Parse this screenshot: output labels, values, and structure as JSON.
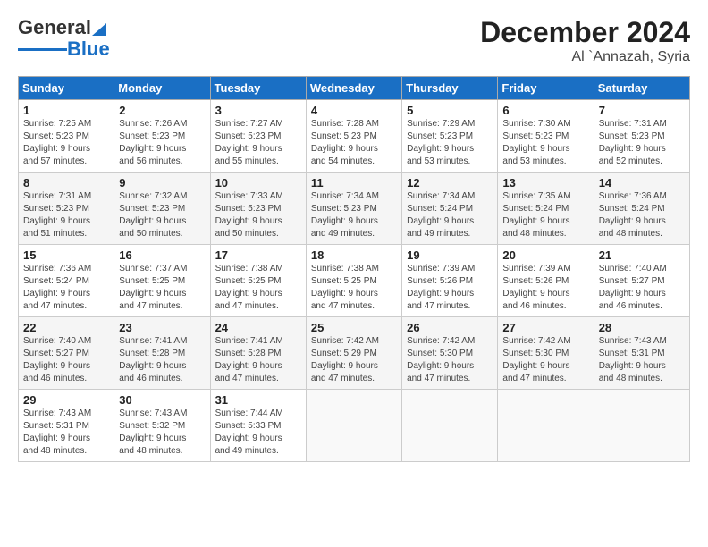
{
  "header": {
    "logo_line1": "General",
    "logo_line2": "Blue",
    "title": "December 2024",
    "subtitle": "Al `Annazah, Syria"
  },
  "columns": [
    "Sunday",
    "Monday",
    "Tuesday",
    "Wednesday",
    "Thursday",
    "Friday",
    "Saturday"
  ],
  "weeks": [
    [
      {
        "day": "1",
        "info": "Sunrise: 7:25 AM\nSunset: 5:23 PM\nDaylight: 9 hours\nand 57 minutes."
      },
      {
        "day": "2",
        "info": "Sunrise: 7:26 AM\nSunset: 5:23 PM\nDaylight: 9 hours\nand 56 minutes."
      },
      {
        "day": "3",
        "info": "Sunrise: 7:27 AM\nSunset: 5:23 PM\nDaylight: 9 hours\nand 55 minutes."
      },
      {
        "day": "4",
        "info": "Sunrise: 7:28 AM\nSunset: 5:23 PM\nDaylight: 9 hours\nand 54 minutes."
      },
      {
        "day": "5",
        "info": "Sunrise: 7:29 AM\nSunset: 5:23 PM\nDaylight: 9 hours\nand 53 minutes."
      },
      {
        "day": "6",
        "info": "Sunrise: 7:30 AM\nSunset: 5:23 PM\nDaylight: 9 hours\nand 53 minutes."
      },
      {
        "day": "7",
        "info": "Sunrise: 7:31 AM\nSunset: 5:23 PM\nDaylight: 9 hours\nand 52 minutes."
      }
    ],
    [
      {
        "day": "8",
        "info": "Sunrise: 7:31 AM\nSunset: 5:23 PM\nDaylight: 9 hours\nand 51 minutes."
      },
      {
        "day": "9",
        "info": "Sunrise: 7:32 AM\nSunset: 5:23 PM\nDaylight: 9 hours\nand 50 minutes."
      },
      {
        "day": "10",
        "info": "Sunrise: 7:33 AM\nSunset: 5:23 PM\nDaylight: 9 hours\nand 50 minutes."
      },
      {
        "day": "11",
        "info": "Sunrise: 7:34 AM\nSunset: 5:23 PM\nDaylight: 9 hours\nand 49 minutes."
      },
      {
        "day": "12",
        "info": "Sunrise: 7:34 AM\nSunset: 5:24 PM\nDaylight: 9 hours\nand 49 minutes."
      },
      {
        "day": "13",
        "info": "Sunrise: 7:35 AM\nSunset: 5:24 PM\nDaylight: 9 hours\nand 48 minutes."
      },
      {
        "day": "14",
        "info": "Sunrise: 7:36 AM\nSunset: 5:24 PM\nDaylight: 9 hours\nand 48 minutes."
      }
    ],
    [
      {
        "day": "15",
        "info": "Sunrise: 7:36 AM\nSunset: 5:24 PM\nDaylight: 9 hours\nand 47 minutes."
      },
      {
        "day": "16",
        "info": "Sunrise: 7:37 AM\nSunset: 5:25 PM\nDaylight: 9 hours\nand 47 minutes."
      },
      {
        "day": "17",
        "info": "Sunrise: 7:38 AM\nSunset: 5:25 PM\nDaylight: 9 hours\nand 47 minutes."
      },
      {
        "day": "18",
        "info": "Sunrise: 7:38 AM\nSunset: 5:25 PM\nDaylight: 9 hours\nand 47 minutes."
      },
      {
        "day": "19",
        "info": "Sunrise: 7:39 AM\nSunset: 5:26 PM\nDaylight: 9 hours\nand 47 minutes."
      },
      {
        "day": "20",
        "info": "Sunrise: 7:39 AM\nSunset: 5:26 PM\nDaylight: 9 hours\nand 46 minutes."
      },
      {
        "day": "21",
        "info": "Sunrise: 7:40 AM\nSunset: 5:27 PM\nDaylight: 9 hours\nand 46 minutes."
      }
    ],
    [
      {
        "day": "22",
        "info": "Sunrise: 7:40 AM\nSunset: 5:27 PM\nDaylight: 9 hours\nand 46 minutes."
      },
      {
        "day": "23",
        "info": "Sunrise: 7:41 AM\nSunset: 5:28 PM\nDaylight: 9 hours\nand 46 minutes."
      },
      {
        "day": "24",
        "info": "Sunrise: 7:41 AM\nSunset: 5:28 PM\nDaylight: 9 hours\nand 47 minutes."
      },
      {
        "day": "25",
        "info": "Sunrise: 7:42 AM\nSunset: 5:29 PM\nDaylight: 9 hours\nand 47 minutes."
      },
      {
        "day": "26",
        "info": "Sunrise: 7:42 AM\nSunset: 5:30 PM\nDaylight: 9 hours\nand 47 minutes."
      },
      {
        "day": "27",
        "info": "Sunrise: 7:42 AM\nSunset: 5:30 PM\nDaylight: 9 hours\nand 47 minutes."
      },
      {
        "day": "28",
        "info": "Sunrise: 7:43 AM\nSunset: 5:31 PM\nDaylight: 9 hours\nand 48 minutes."
      }
    ],
    [
      {
        "day": "29",
        "info": "Sunrise: 7:43 AM\nSunset: 5:31 PM\nDaylight: 9 hours\nand 48 minutes."
      },
      {
        "day": "30",
        "info": "Sunrise: 7:43 AM\nSunset: 5:32 PM\nDaylight: 9 hours\nand 48 minutes."
      },
      {
        "day": "31",
        "info": "Sunrise: 7:44 AM\nSunset: 5:33 PM\nDaylight: 9 hours\nand 49 minutes."
      },
      {
        "day": "",
        "info": ""
      },
      {
        "day": "",
        "info": ""
      },
      {
        "day": "",
        "info": ""
      },
      {
        "day": "",
        "info": ""
      }
    ]
  ]
}
